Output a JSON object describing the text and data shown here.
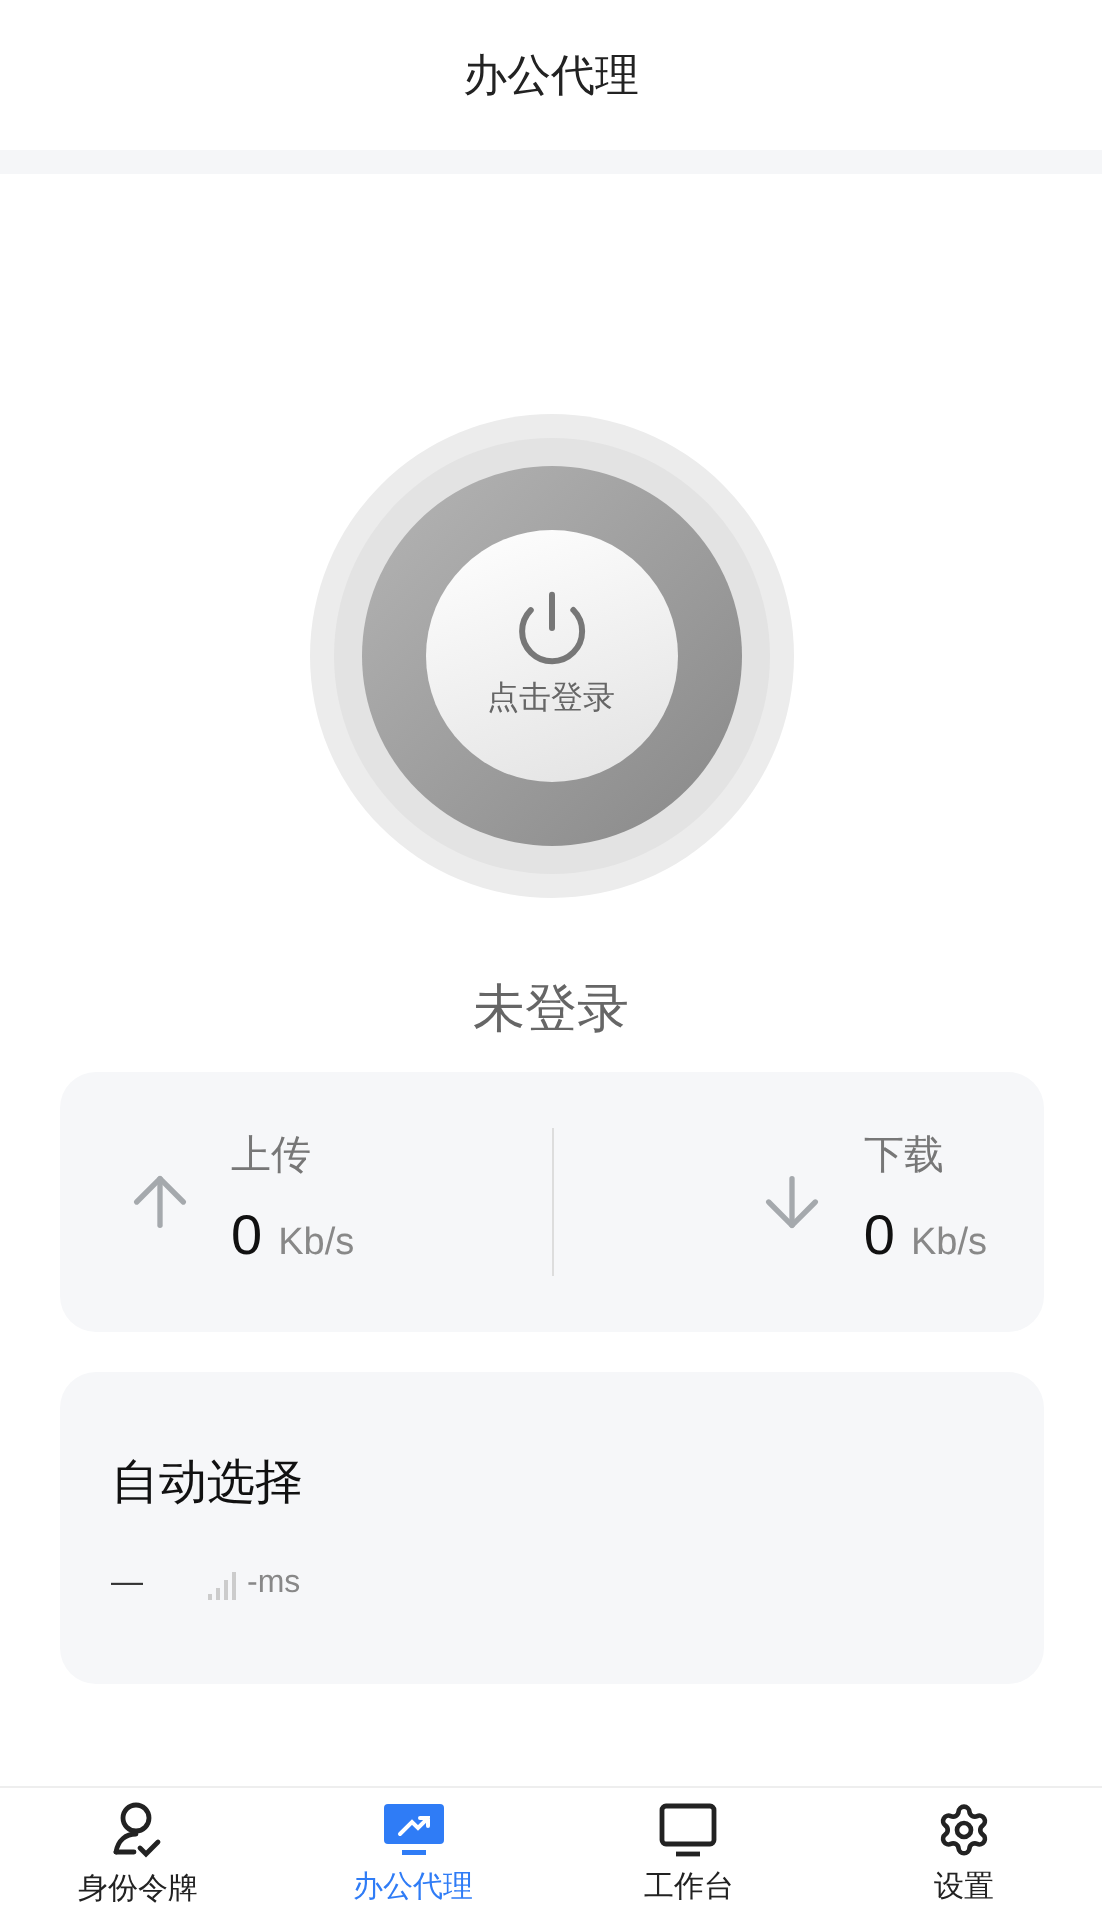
{
  "header": {
    "title": "办公代理"
  },
  "power_button": {
    "label": "点击登录"
  },
  "status": "未登录",
  "traffic": [
    {
      "kind": "upload",
      "label": "上传",
      "value": "0",
      "unit": "Kb/s"
    },
    {
      "kind": "download",
      "label": "下载",
      "value": "0",
      "unit": "Kb/s"
    }
  ],
  "node": {
    "name": "自动选择",
    "dash": "—",
    "latency": "-ms"
  },
  "tabs": [
    {
      "kind": "identity",
      "label": "身份令牌",
      "selected": false
    },
    {
      "kind": "proxy",
      "label": "办公代理",
      "selected": true
    },
    {
      "kind": "workbench",
      "label": "工作台",
      "selected": false
    },
    {
      "kind": "settings",
      "label": "设置",
      "selected": false
    }
  ]
}
